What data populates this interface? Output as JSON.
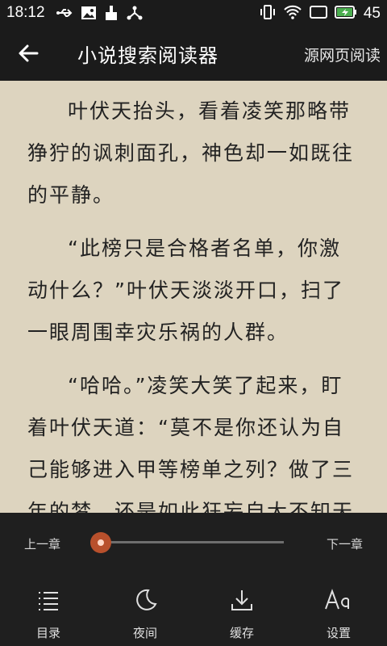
{
  "status": {
    "time": "18:12",
    "battery_pct": "45",
    "left_icons": [
      "usb-icon",
      "image-icon",
      "broom-icon",
      "share-icon"
    ],
    "right_icons": [
      "vibrate-icon",
      "wifi-icon",
      "screen-icon",
      "battery-charging-icon"
    ]
  },
  "appbar": {
    "title": "小说搜索阅读器",
    "action": "源网页阅读"
  },
  "content": {
    "paragraphs": [
      "叶伏天抬头，看着凌笑那略带狰狞的讽刺面孔，神色却一如既往的平静。",
      "“此榜只是合格者名单，你激动什么？”叶伏天淡淡开口，扫了一眼周围幸灾乐祸的人群。",
      "“哈哈。”凌笑大笑了起来，盯着叶伏天道：“莫不是你还认为自己能够进入甲等榜单之列？做了三年的梦，还是如此狂妄自大不知天高地厚，都到这时候竟然还"
    ]
  },
  "reader": {
    "prev_chapter": "上一章",
    "next_chapter": "下一章",
    "progress": 0.04
  },
  "nav": {
    "items": [
      {
        "label": "目录",
        "icon": "list-icon"
      },
      {
        "label": "夜间",
        "icon": "moon-icon"
      },
      {
        "label": "缓存",
        "icon": "download-icon"
      },
      {
        "label": "设置",
        "icon": "font-icon"
      }
    ]
  },
  "colors": {
    "bar_bg": "#1b1b1b",
    "page_bg": "#ddd4bf",
    "accent": "#b8502c"
  }
}
